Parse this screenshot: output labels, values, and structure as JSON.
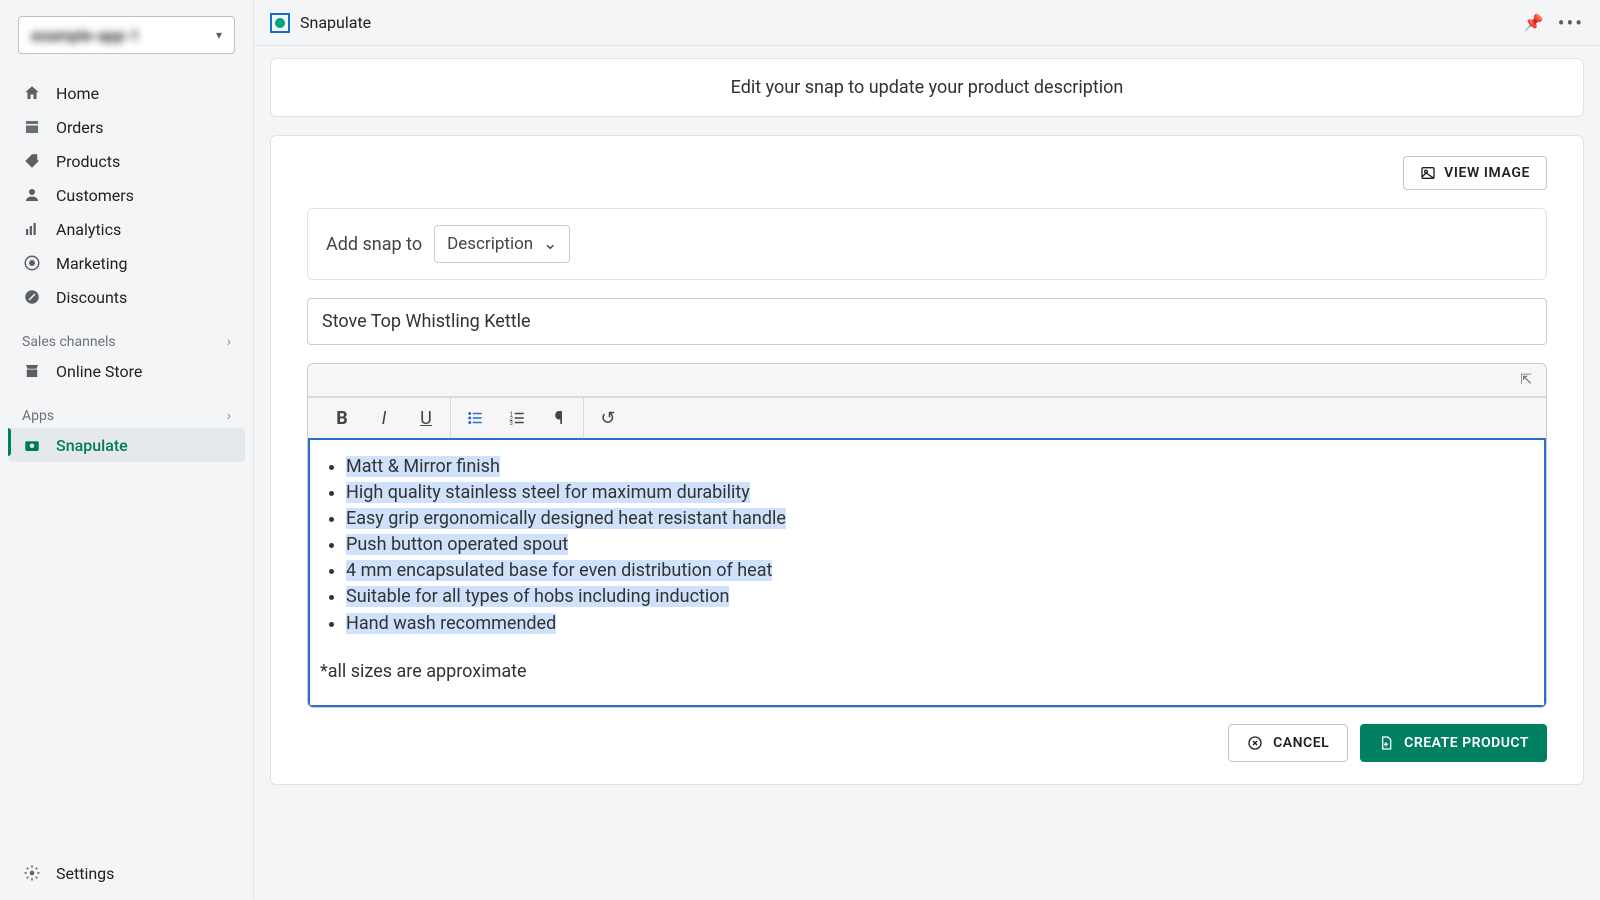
{
  "store_name": "example-app-1",
  "sidebar": {
    "items": [
      {
        "label": "Home"
      },
      {
        "label": "Orders"
      },
      {
        "label": "Products"
      },
      {
        "label": "Customers"
      },
      {
        "label": "Analytics"
      },
      {
        "label": "Marketing"
      },
      {
        "label": "Discounts"
      }
    ],
    "sales_channels_label": "Sales channels",
    "online_store_label": "Online Store",
    "apps_label": "Apps",
    "active_app": "Snapulate",
    "settings_label": "Settings"
  },
  "topbar": {
    "app_name": "Snapulate"
  },
  "banner_text": "Edit your snap to update your product description",
  "view_image_label": "VIEW IMAGE",
  "add_snap_label": "Add snap to",
  "add_snap_select": "Description",
  "product_title": "Stove Top Whistling Kettle",
  "editor": {
    "bullets": [
      "Matt & Mirror finish",
      "High quality stainless steel for maximum durability",
      "Easy grip ergonomically designed heat resistant handle",
      "Push button operated spout",
      "4 mm encapsulated base for even distribution of heat",
      "Suitable for all types of hobs including induction",
      "Hand wash recommended"
    ],
    "footnote": "*all sizes are approximate"
  },
  "actions": {
    "cancel": "CANCEL",
    "create": "CREATE PRODUCT"
  }
}
